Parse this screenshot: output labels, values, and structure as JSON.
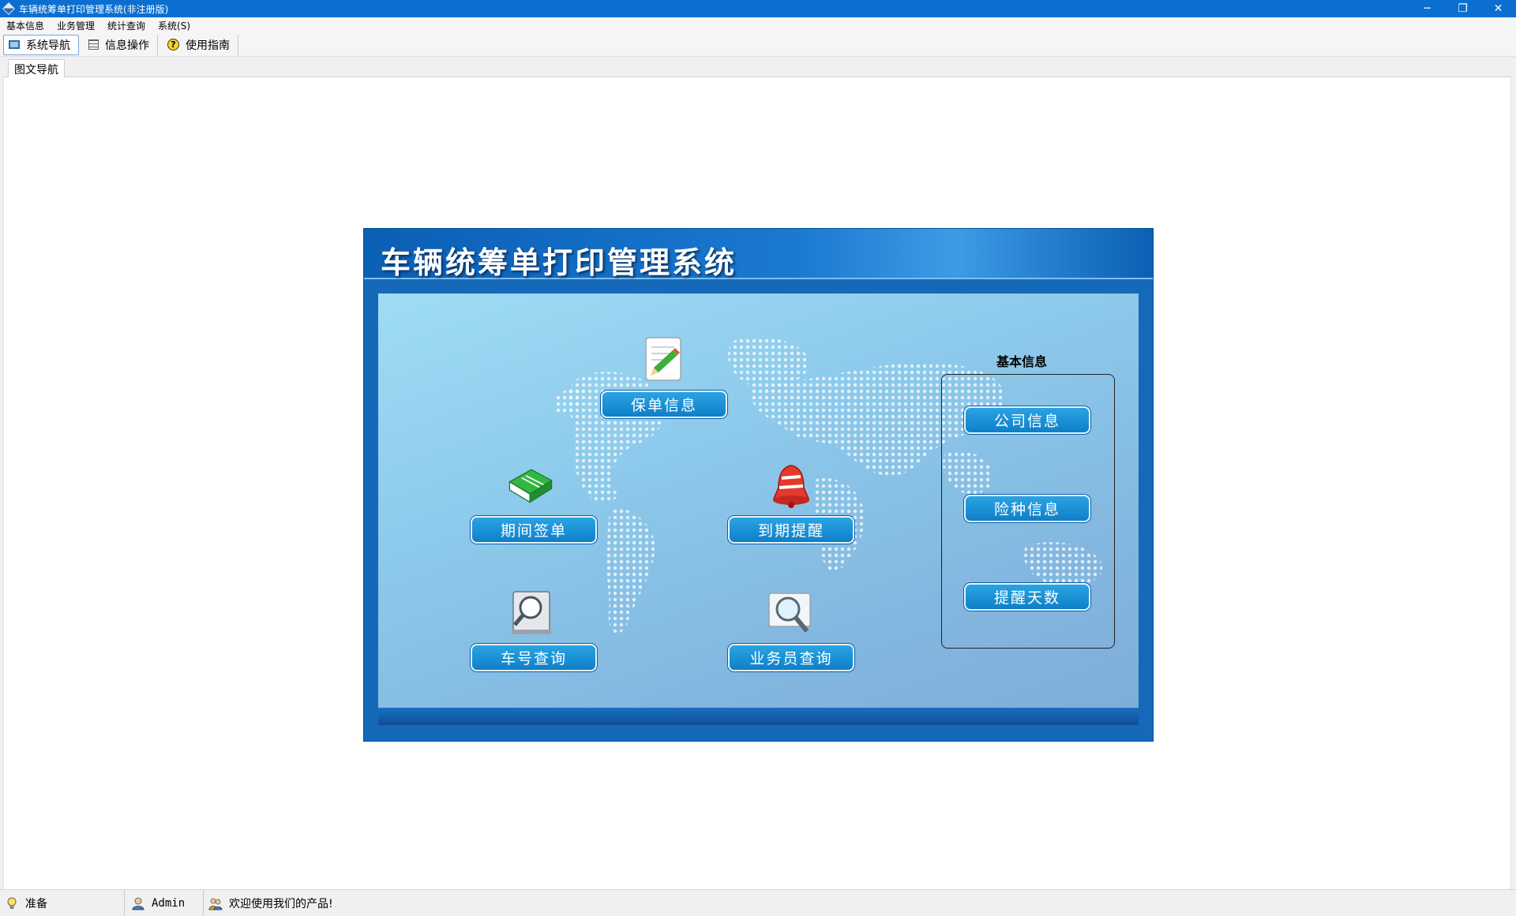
{
  "window": {
    "title": "车辆统筹单打印管理系统(非注册版)",
    "controls": {
      "minimize": "─",
      "restore": "❐",
      "close": "✕"
    }
  },
  "menubar": {
    "items": [
      "基本信息",
      "业务管理",
      "统计查询",
      "系统(S)"
    ]
  },
  "toolbar": {
    "items": [
      {
        "label": "系统导航",
        "icon": "monitor-icon",
        "active": true
      },
      {
        "label": "信息操作",
        "icon": "grid-icon",
        "active": false
      },
      {
        "label": "使用指南",
        "icon": "help-icon",
        "active": false
      }
    ]
  },
  "tabs": {
    "items": [
      "图文导航"
    ]
  },
  "panel": {
    "title": "车辆统筹单打印管理系统",
    "buttons": {
      "policy": "保单信息",
      "period_sign": "期间签单",
      "expiry_reminder": "到期提醒",
      "plate_query": "车号查询",
      "salesman_query": "业务员查询"
    },
    "basic_group": {
      "title": "基本信息",
      "buttons": [
        "公司信息",
        "险种信息",
        "提醒天数"
      ]
    }
  },
  "statusbar": {
    "ready": "准备",
    "user": "Admin",
    "message": "欢迎使用我们的产品!"
  },
  "colors": {
    "titlebar": "#0a6fd0",
    "panel": "#1569b8",
    "button": "#1a8fd6"
  }
}
